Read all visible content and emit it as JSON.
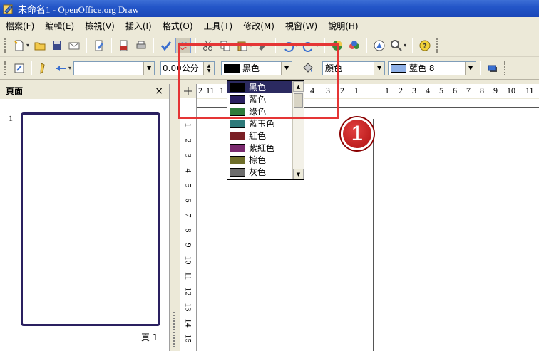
{
  "window": {
    "title": "未命名1 - OpenOffice.org Draw"
  },
  "menu": [
    "檔案(F)",
    "編輯(E)",
    "檢視(V)",
    "插入(I)",
    "格式(O)",
    "工具(T)",
    "修改(M)",
    "視窗(W)",
    "說明(H)"
  ],
  "toolbar2": {
    "line_width_value": "0.00公分",
    "line_color_value": "黑色",
    "area_style_value": "顏色",
    "area_color_value": "藍色 8"
  },
  "colors": {
    "black": "#000000",
    "blue": "#2a2060",
    "green": "#2f7a3a",
    "blue_jade": "#2e7a7a",
    "red": "#7a1f25",
    "magenta": "#7a2a6e",
    "brown": "#6e6e2a",
    "gray": "#6d6d6d",
    "area_blue8": "#8fb0e6",
    "accent_red": "#e53535",
    "selection": "#2b2a60"
  },
  "color_dropdown": {
    "items": [
      {
        "label": "黑色",
        "color": "#000000"
      },
      {
        "label": "藍色",
        "color": "#2a2060"
      },
      {
        "label": "綠色",
        "color": "#2f7a3a"
      },
      {
        "label": "藍玉色",
        "color": "#2e7a7a"
      },
      {
        "label": "紅色",
        "color": "#7a1f25"
      },
      {
        "label": "紫紅色",
        "color": "#7a2a6e"
      },
      {
        "label": "棕色",
        "color": "#6e6e2a"
      },
      {
        "label": "灰色",
        "color": "#6d6d6d"
      }
    ]
  },
  "pane": {
    "title": "頁面",
    "close": "×",
    "page_number": "1",
    "page_label": "頁 1"
  },
  "ruler_h": {
    "left_ticks": [
      "2",
      "11",
      "1",
      "4",
      "3",
      "2",
      "1"
    ],
    "right_ticks": [
      "1",
      "2",
      "3",
      "4",
      "5",
      "6",
      "7",
      "8",
      "9",
      "10",
      "11"
    ]
  },
  "ruler_v": {
    "ticks": [
      "1",
      "2",
      "3",
      "4",
      "5",
      "6",
      "7",
      "8",
      "9",
      "10",
      "11",
      "12",
      "13",
      "14",
      "15"
    ]
  },
  "annotation": {
    "step": "1"
  }
}
